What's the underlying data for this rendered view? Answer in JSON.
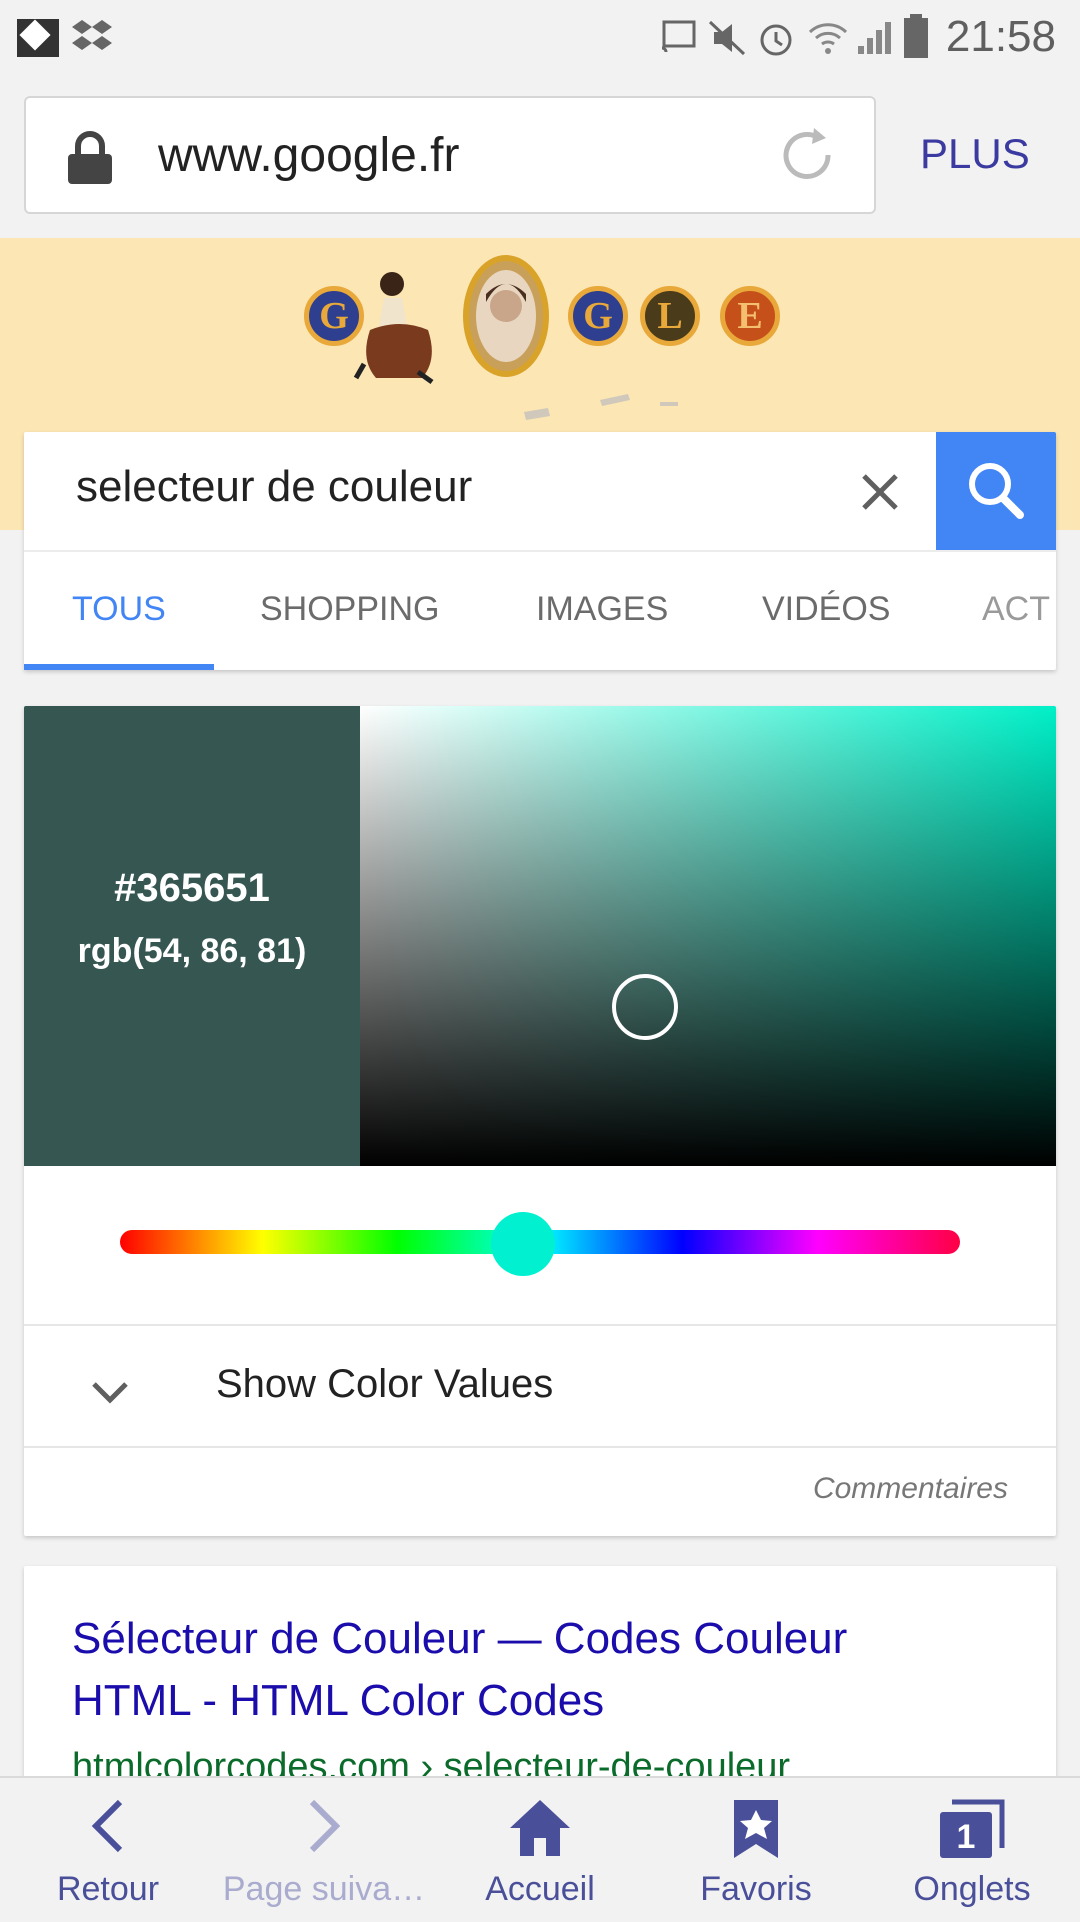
{
  "status_bar": {
    "time": "21:58",
    "icons": [
      "app-icon",
      "dropbox-icon",
      "cast-icon",
      "mute-icon",
      "alarm-icon",
      "wifi-icon",
      "signal-icon",
      "battery-icon"
    ]
  },
  "address_bar": {
    "url": "www.google.fr",
    "menu_label": "PLUS"
  },
  "doodle": {
    "letters": [
      "G",
      "G",
      "L",
      "E"
    ]
  },
  "search": {
    "query": "selecteur de couleur",
    "tabs": [
      {
        "label": "TOUS",
        "active": true
      },
      {
        "label": "SHOPPING",
        "active": false
      },
      {
        "label": "IMAGES",
        "active": false
      },
      {
        "label": "VIDÉOS",
        "active": false
      },
      {
        "label": "ACT",
        "active": false
      }
    ]
  },
  "color_picker": {
    "hex": "#365651",
    "rgb": "rgb(54, 86, 81)",
    "show_values_label": "Show Color Values",
    "feedback_label": "Commentaires",
    "hue_fraction": 0.48
  },
  "result": {
    "title": "Sélecteur de Couleur — Codes Couleur HTML - HTML Color Codes",
    "url": "htmlcolorcodes.com › selecteur-de-couleur"
  },
  "bottom_nav": {
    "items": [
      {
        "label": "Retour",
        "icon": "back-arrow-icon",
        "disabled": false
      },
      {
        "label": "Page suiva…",
        "icon": "forward-arrow-icon",
        "disabled": true
      },
      {
        "label": "Accueil",
        "icon": "home-icon",
        "disabled": false
      },
      {
        "label": "Favoris",
        "icon": "bookmark-star-icon",
        "disabled": false
      },
      {
        "label": "Onglets",
        "icon": "tabs-icon",
        "disabled": false,
        "badge": "1"
      }
    ]
  },
  "colors": {
    "accent_blue": "#4285f4",
    "link_blue": "#1a0dab",
    "url_green": "#0b6b2b",
    "nav_purple": "#4a4f9a",
    "doodle_bg": "#fbe6b4"
  }
}
